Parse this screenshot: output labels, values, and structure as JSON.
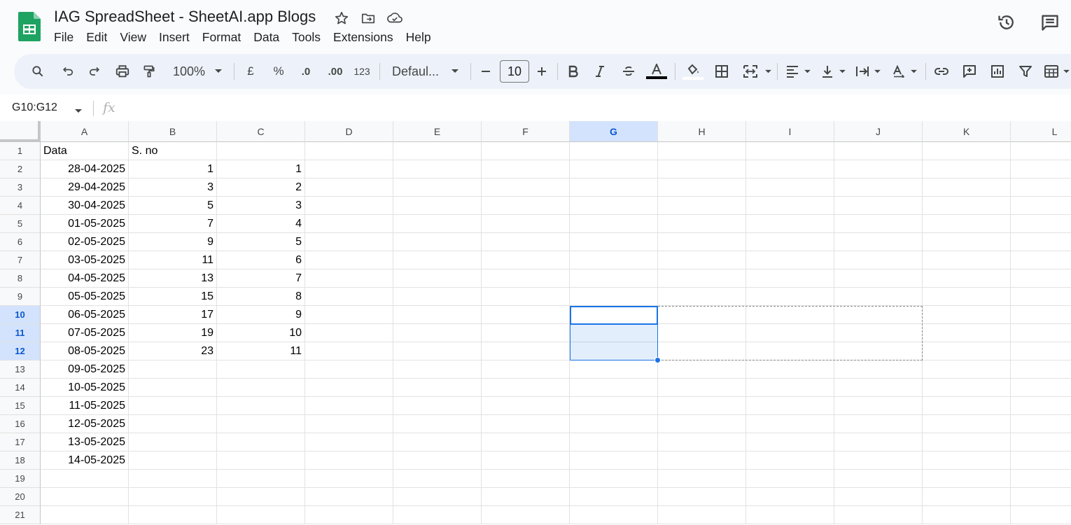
{
  "doc": {
    "title": "IAG SpreadSheet - SheetAI.app Blogs",
    "menus": [
      "File",
      "Edit",
      "View",
      "Insert",
      "Format",
      "Data",
      "Tools",
      "Extensions",
      "Help"
    ]
  },
  "toolbar": {
    "zoom": "100%",
    "currency": "£",
    "percent": "%",
    "decrease_decimal": ".0",
    "increase_decimal": ".00",
    "number_format": "123",
    "font": "Defaul...",
    "font_size": "10"
  },
  "formula_bar": {
    "name_box": "G10:G12",
    "fx": "fx"
  },
  "sheet": {
    "columns": [
      "A",
      "B",
      "C",
      "D",
      "E",
      "F",
      "G",
      "H",
      "I",
      "J",
      "K",
      "L"
    ],
    "selected_column": "G",
    "rows": [
      "1",
      "2",
      "3",
      "4",
      "5",
      "6",
      "7",
      "8",
      "9",
      "10",
      "11",
      "12",
      "13",
      "14",
      "15",
      "16",
      "17",
      "18",
      "19",
      "20",
      "21"
    ],
    "selected_rows": [
      "10",
      "11",
      "12"
    ],
    "headers": {
      "A": "Data",
      "B": "S. no",
      "C": ""
    },
    "dates": [
      "28-04-2025",
      "29-04-2025",
      "30-04-2025",
      "01-05-2025",
      "02-05-2025",
      "03-05-2025",
      "04-05-2025",
      "05-05-2025",
      "06-05-2025",
      "07-05-2025",
      "08-05-2025",
      "09-05-2025",
      "10-05-2025",
      "11-05-2025",
      "12-05-2025",
      "13-05-2025",
      "14-05-2025"
    ],
    "col_b": [
      "1",
      "3",
      "5",
      "7",
      "9",
      "11",
      "13",
      "15",
      "17",
      "19",
      "23"
    ],
    "col_c": [
      "1",
      "2",
      "3",
      "4",
      "5",
      "6",
      "7",
      "8",
      "9",
      "10",
      "11"
    ],
    "selection": "G10:G12"
  }
}
